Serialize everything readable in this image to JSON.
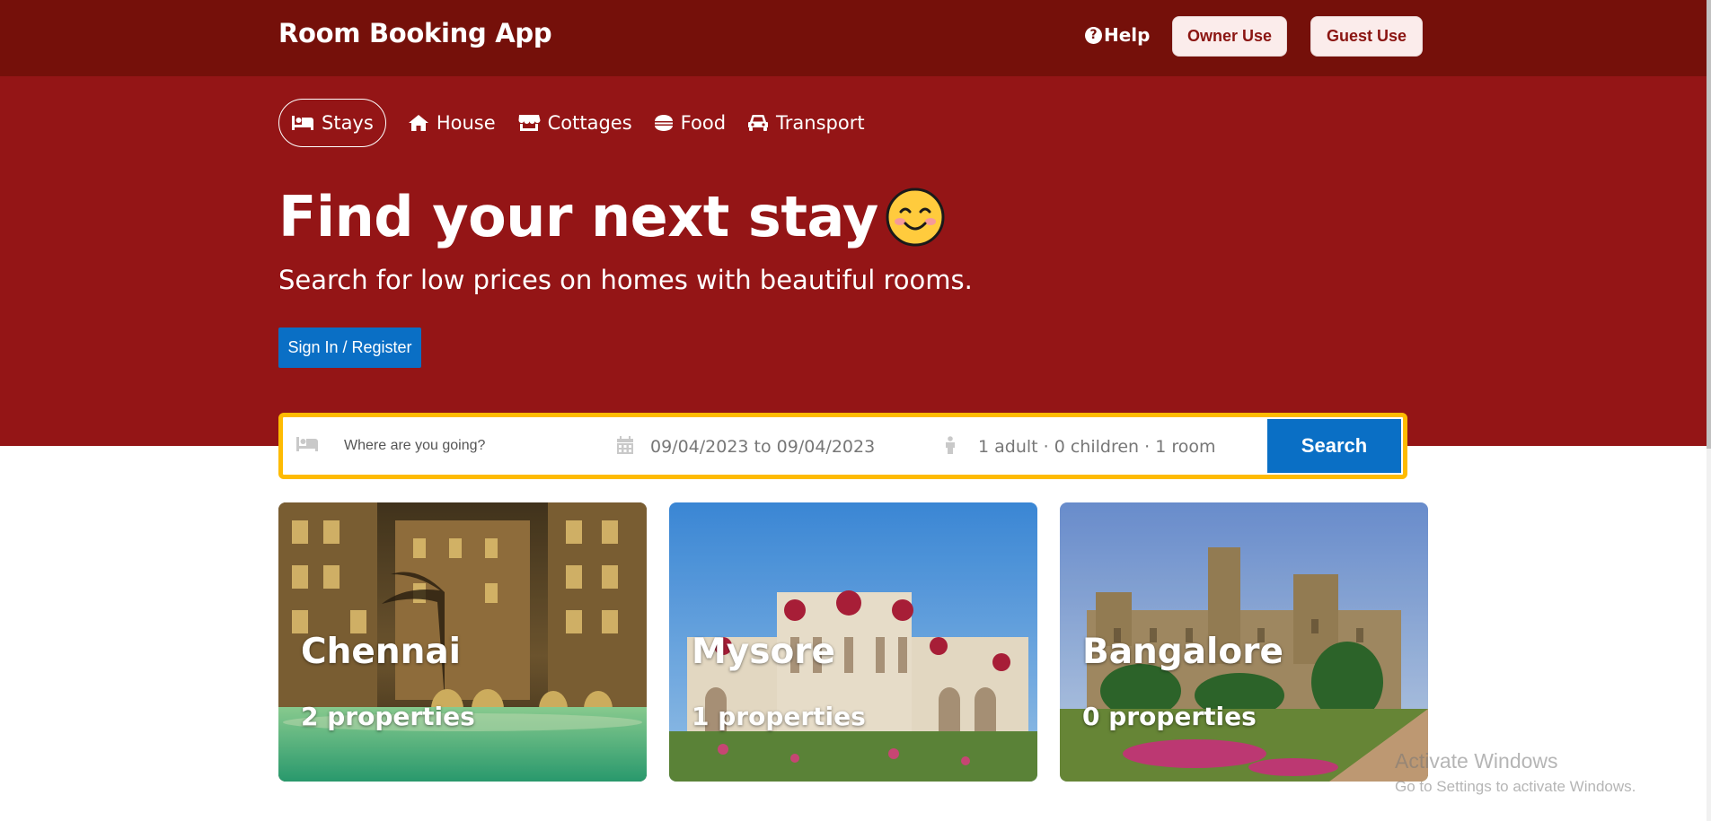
{
  "header": {
    "brand": "Room Booking App",
    "help_label": "Help",
    "owner_label": "Owner Use",
    "guest_label": "Guest Use"
  },
  "tabs": [
    {
      "label": "Stays",
      "icon": "bed-icon",
      "active": true
    },
    {
      "label": "House",
      "icon": "house-icon"
    },
    {
      "label": "Cottages",
      "icon": "store-icon"
    },
    {
      "label": "Food",
      "icon": "food-bowl-icon"
    },
    {
      "label": "Transport",
      "icon": "car-icon"
    }
  ],
  "hero": {
    "headline": "Find your next stay",
    "emoji": "smiling-face-emoji",
    "subhead": "Search for low prices on homes with beautiful rooms.",
    "signin_label": "Sign In / Register"
  },
  "search": {
    "placeholder": "Where are you going?",
    "destination_value": "",
    "dates": "09/04/2023 to 09/04/2023",
    "guests": "1 adult · 0 children · 1 room",
    "button_label": "Search",
    "border_color": "#febb02",
    "button_color": "#0a6fc5"
  },
  "cities": [
    {
      "name": "Chennai",
      "properties": "2 properties"
    },
    {
      "name": "Mysore",
      "properties": "1 properties"
    },
    {
      "name": "Bangalore",
      "properties": "0 properties"
    }
  ],
  "watermark": {
    "title": "Activate Windows",
    "subtitle": "Go to Settings to activate Windows."
  },
  "colors": {
    "topbar": "#75100a",
    "hero": "#941516",
    "accent_blue": "#0a6fc5"
  }
}
